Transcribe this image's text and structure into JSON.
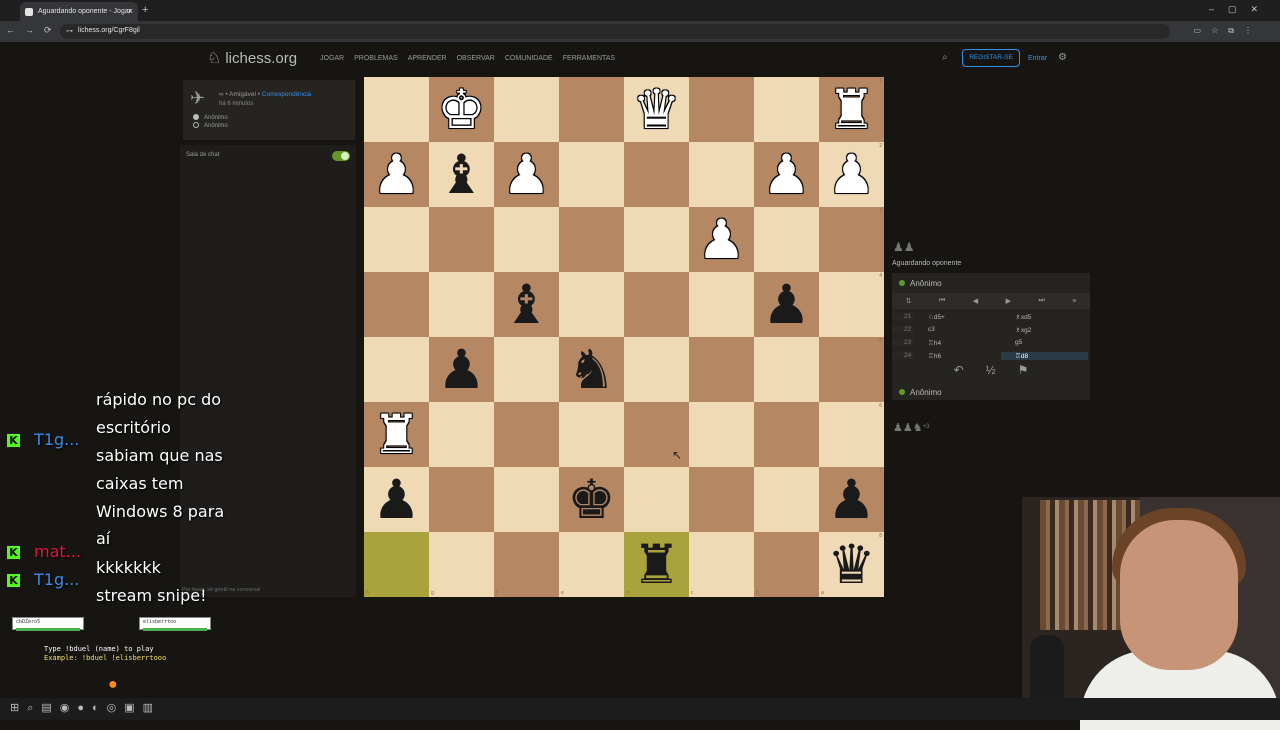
{
  "browser": {
    "tab_title": "Aguardando oponente - Jogar",
    "url": "lichess.org/CgrF8gil"
  },
  "header": {
    "logo": "lichess.org",
    "nav": [
      "JOGAR",
      "PROBLEMAS",
      "APRENDER",
      "OBSERVAR",
      "COMUNIDADE",
      "FERRAMENTAS"
    ],
    "register": "REGISTAR-SE",
    "signin": "Entrar"
  },
  "game": {
    "type_prefix": "∞ • Amigável • ",
    "type_link": "Correspondência",
    "time_ago": "há 6 minutos",
    "white": "Anônimo",
    "black": "Anônimo"
  },
  "chat": {
    "title": "Sala de chat",
    "placeholder": "Por favor, sê gentil na conversa!"
  },
  "board": {
    "pieces": [
      [
        "",
        "K",
        "",
        "",
        "Q",
        "",
        "",
        "R"
      ],
      [
        "P",
        "b",
        "P",
        "",
        "",
        "",
        "P",
        "P"
      ],
      [
        "",
        "",
        "",
        "",
        "",
        "P",
        "",
        ""
      ],
      [
        "",
        "",
        "b",
        "",
        "",
        "",
        "p",
        ""
      ],
      [
        "",
        "p",
        "",
        "n",
        "",
        "",
        "",
        ""
      ],
      [
        "R",
        "",
        "",
        "",
        "",
        "",
        "",
        ""
      ],
      [
        "p",
        "",
        "",
        "k",
        "",
        "",
        "",
        "p"
      ],
      [
        "",
        "",
        "",
        "",
        "r",
        "",
        "",
        "q"
      ]
    ],
    "highlight": [
      [
        7,
        0
      ],
      [
        7,
        4
      ]
    ],
    "file_labels": [
      "h",
      "g",
      "f",
      "e",
      "d",
      "c",
      "b",
      "a"
    ],
    "rank_labels": [
      "1",
      "2",
      "3",
      "4",
      "5",
      "6",
      "7",
      "8"
    ]
  },
  "right_panel": {
    "status": "Aguardando oponente",
    "top_player": "Anônimo",
    "bottom_player": "Anônimo",
    "captured_top": "♟♟",
    "captured_bottom": "♟♟♞",
    "captured_bottom_score": "+3",
    "moves": [
      {
        "n": "21",
        "w": "♘d5+",
        "b": "♗xd5"
      },
      {
        "n": "22",
        "w": "c3",
        "b": "♗xg2"
      },
      {
        "n": "23",
        "w": "♖h4",
        "b": "g5"
      },
      {
        "n": "24",
        "w": "♖h6",
        "b": "♖d8"
      }
    ]
  },
  "stream_chat": [
    {
      "user": "",
      "text": "rápido no pc do"
    },
    {
      "user": "",
      "text": "escritório"
    },
    {
      "user": "T1g...",
      "text": "sabiam que nas",
      "color": "#3b8beb"
    },
    {
      "user": "",
      "text": "caixas tem"
    },
    {
      "user": "",
      "text": "Windows 8 para"
    },
    {
      "user": "",
      "text": "aí"
    },
    {
      "user": "mat...",
      "text": "kkkkkkk",
      "color": "#e2143d"
    },
    {
      "user": "T1g...",
      "text": "stream snipe!",
      "color": "#3b8beb"
    }
  ],
  "duel": {
    "hint1": "Type !bduel (name) to play",
    "hint2": "Example: !bduel !elisberrtooo",
    "bar1": "cbDZero5",
    "bar2": "elisberrtoo"
  },
  "colors": {
    "accent": "#3692e7",
    "online": "#629924",
    "light_square": "#f0d9b5",
    "dark_square": "#b58863",
    "highlight": "#aaa23a"
  }
}
